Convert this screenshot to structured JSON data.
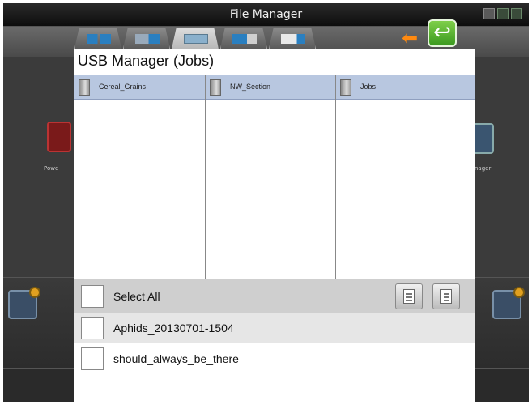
{
  "window": {
    "title": "File Manager"
  },
  "icons": {
    "status": [
      "usb-icon",
      "gps-icon",
      "signal-icon"
    ],
    "back": "back-arrow-icon",
    "orange_arrow": "left-arrow-icon"
  },
  "tabs": [
    {
      "name": "tab-display",
      "icon": "display-icon",
      "active": false
    },
    {
      "name": "tab-transfer",
      "icon": "transfer-icon",
      "active": false
    },
    {
      "name": "tab-usb",
      "icon": "usb-drive-icon",
      "active": true
    },
    {
      "name": "tab-settings",
      "icon": "settings-icon",
      "active": false
    },
    {
      "name": "tab-export",
      "icon": "export-icon",
      "active": false
    }
  ],
  "dialog": {
    "title": "USB Manager (Jobs)",
    "folders": [
      "Cereal_Grains",
      "NW_Section",
      "Jobs"
    ],
    "select_all_label": "Select All",
    "files": [
      "Aphids_20130701-1504",
      "should_always_be_there"
    ]
  },
  "colors": {
    "folder_header": "#b8c7e0",
    "select_bar": "#cfcfcf",
    "back_button": "#4fae2a",
    "orange_arrow": "#ff8a10"
  }
}
